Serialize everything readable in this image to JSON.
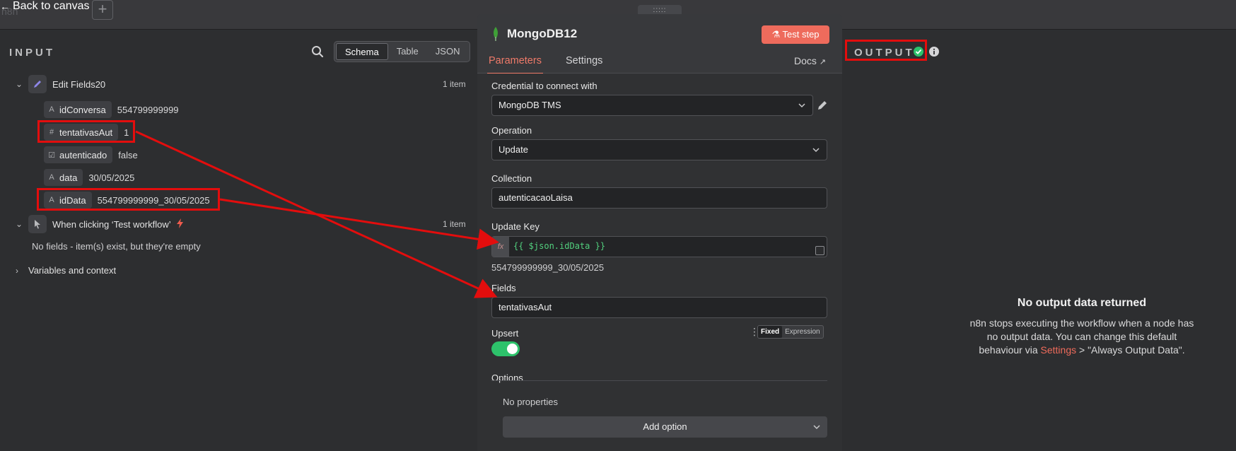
{
  "topbar": {
    "back_label": "Back to canvas",
    "ghost_logo": "n8n",
    "add_button": "+"
  },
  "input_panel": {
    "title": "INPUT",
    "view_tabs": [
      "Schema",
      "Table",
      "JSON"
    ],
    "active_view": "Schema",
    "nodes": [
      {
        "name": "Edit Fields20",
        "count": "1 item",
        "fields": [
          {
            "type": "A",
            "name": "idConversa",
            "value": "554799999999"
          },
          {
            "type": "#",
            "name": "tentativasAut",
            "value": "1"
          },
          {
            "type": "☑",
            "name": "autenticado",
            "value": "false"
          },
          {
            "type": "A",
            "name": "data",
            "value": "30/05/2025"
          },
          {
            "type": "A",
            "name": "idData",
            "value": "554799999999_30/05/2025"
          }
        ]
      },
      {
        "name": "When clicking ‘Test workflow’",
        "count": "1 item",
        "empty_note": "No fields - item(s) exist, but they're empty"
      }
    ],
    "variables_label": "Variables and context"
  },
  "node_panel": {
    "title": "MongoDB12",
    "test_button": "Test step",
    "tabs": [
      "Parameters",
      "Settings"
    ],
    "docs_label": "Docs",
    "credential_label": "Credential to connect with",
    "credential_value": "MongoDB TMS",
    "operation_label": "Operation",
    "operation_value": "Update",
    "collection_label": "Collection",
    "collection_value": "autenticacaoLaisa",
    "update_key_label": "Update Key",
    "update_key_expression": "{{ $json.idData }}",
    "update_key_result": "554799999999_30/05/2025",
    "fields_label": "Fields",
    "fields_value": "tentativasAut",
    "upsert_label": "Upsert",
    "upsert_on": true,
    "mode_options": [
      "Fixed",
      "Expression"
    ],
    "options_label": "Options",
    "no_properties": "No properties",
    "add_option": "Add option",
    "drag_handle": ":::::"
  },
  "output_panel": {
    "title": "OUTPUT",
    "no_output_title": "No output data returned",
    "msg_part1": "n8n stops executing the workflow when a node has no output data. You can change this default behaviour via ",
    "msg_link": "Settings",
    "msg_part2": " > \"Always Output Data\"."
  },
  "colors": {
    "accent": "#ef6b5b",
    "annotation_red": "#e30d0d",
    "toggle_green": "#2dc26b",
    "expression_green": "#52d07e"
  }
}
